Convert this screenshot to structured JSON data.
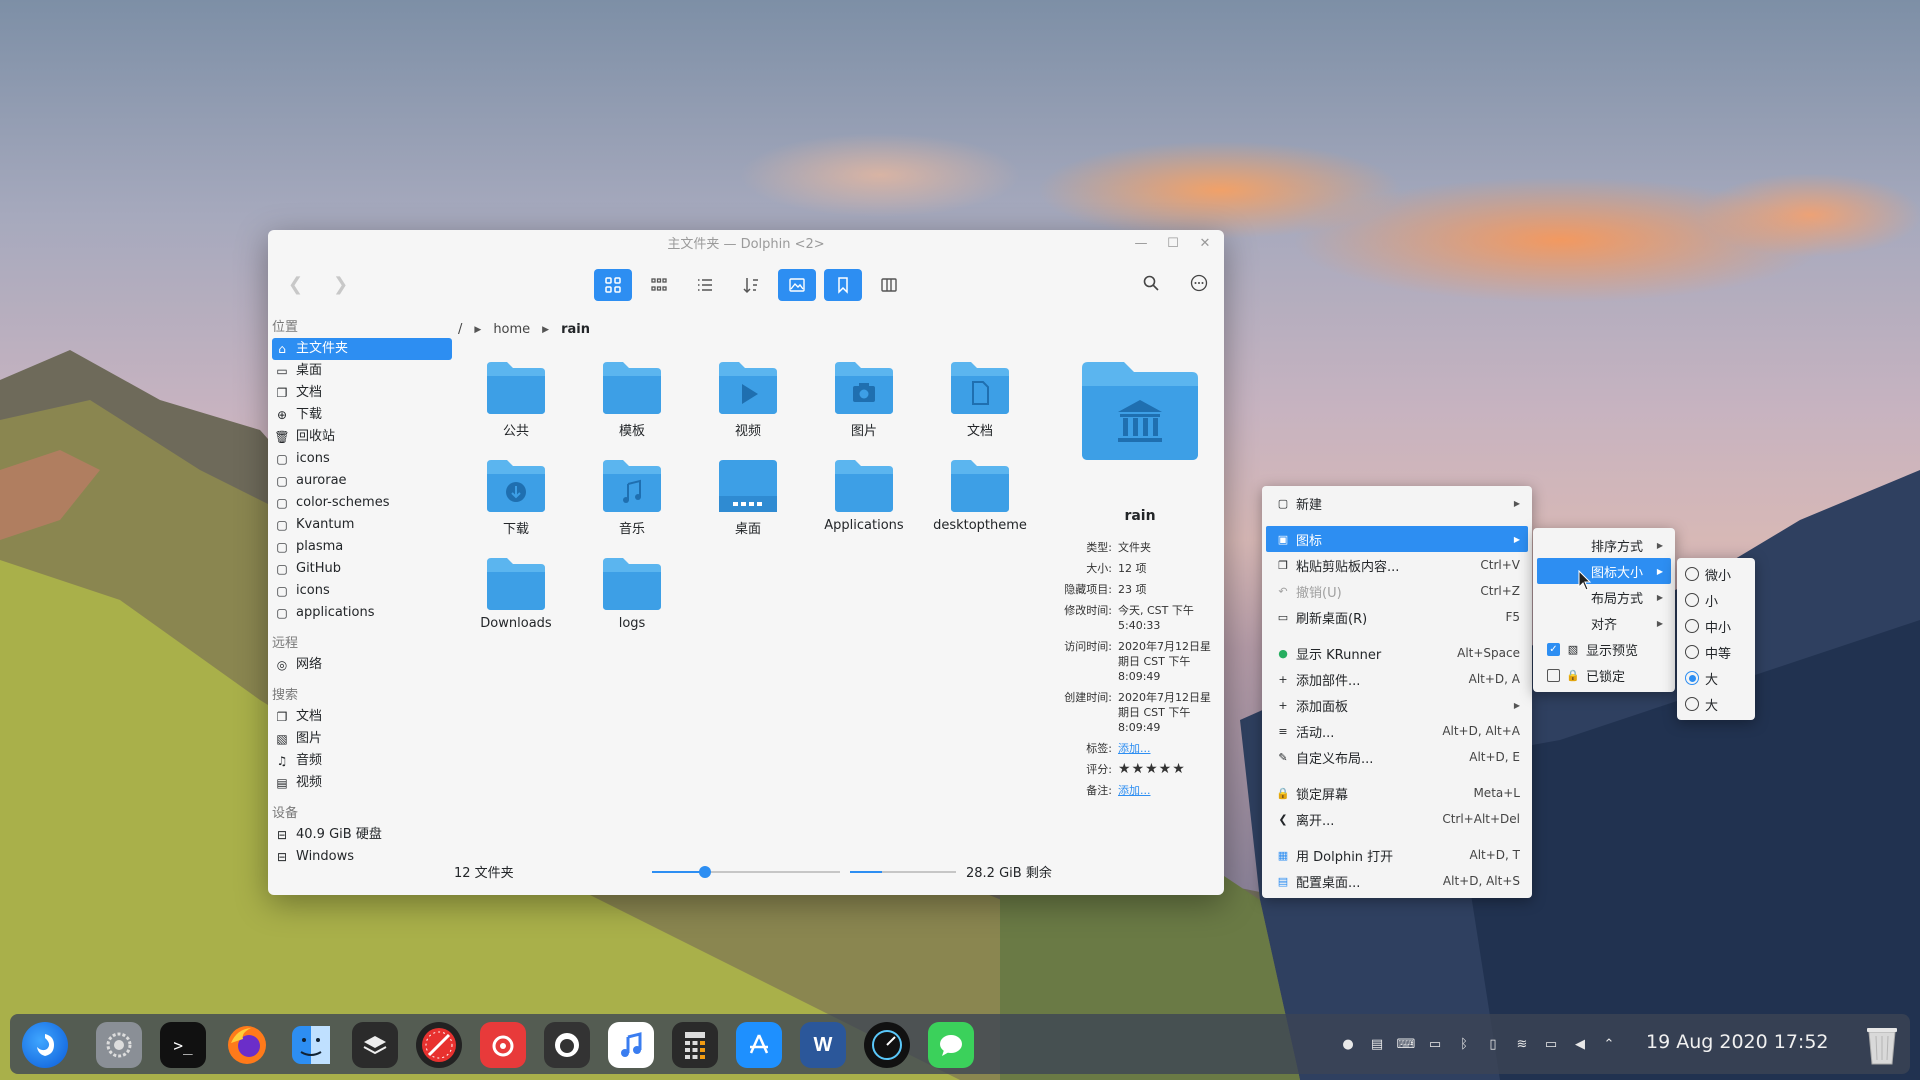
{
  "window": {
    "title": "主文件夹 — Dolphin <2>"
  },
  "sidebar": {
    "sections": {
      "places": "位置",
      "remote": "远程",
      "search": "搜索",
      "devices": "设备"
    },
    "places": [
      "主文件夹",
      "桌面",
      "文档",
      "下载",
      "回收站",
      "icons",
      "aurorae",
      "color-schemes",
      "Kvantum",
      "plasma",
      "GitHub",
      "icons",
      "applications"
    ],
    "remote": [
      "网络"
    ],
    "search": [
      "文档",
      "图片",
      "音频",
      "视频"
    ],
    "devices": [
      "40.9 GiB 硬盘",
      "Windows"
    ]
  },
  "breadcrumb": {
    "root": "/",
    "home": "home",
    "current": "rain"
  },
  "files": [
    "公共",
    "模板",
    "视频",
    "图片",
    "文档",
    "下载",
    "音乐",
    "桌面",
    "Applications",
    "desktoptheme",
    "Downloads",
    "logs"
  ],
  "info": {
    "name": "rain",
    "rows": [
      {
        "k": "类型:",
        "v": "文件夹"
      },
      {
        "k": "大小:",
        "v": "12 项"
      },
      {
        "k": "隐藏项目:",
        "v": "23 项"
      },
      {
        "k": "修改时间:",
        "v": "今天, CST 下午 5:40:33"
      },
      {
        "k": "访问时间:",
        "v": "2020年7月12日星期日 CST 下午 8:09:49"
      },
      {
        "k": "创建时间:",
        "v": "2020年7月12日星期日 CST 下午 8:09:49"
      }
    ],
    "tags_label": "标签:",
    "tags_value": "添加...",
    "rating_label": "评分:",
    "rating_value": "★★★★★",
    "comment_label": "备注:",
    "comment_value": "添加..."
  },
  "status": {
    "count": "12 文件夹",
    "free": "28.2 GiB 剩余",
    "zoom_fraction": 0.28,
    "space_fraction": 0.3
  },
  "menu_main": [
    {
      "icon": "new-icon",
      "label": "新建",
      "shortcut": "",
      "arrow": true
    },
    {
      "sep": true
    },
    {
      "icon": "icons-icon",
      "label": "图标",
      "shortcut": "",
      "arrow": true,
      "hl": true
    },
    {
      "icon": "paste-icon",
      "label": "粘贴剪贴板内容...",
      "shortcut": "Ctrl+V"
    },
    {
      "icon": "undo-icon",
      "label": "撤销(U)",
      "shortcut": "Ctrl+Z",
      "disabled": true
    },
    {
      "icon": "refresh-desktop-icon",
      "label": "刷新桌面(R)",
      "shortcut": "F5"
    },
    {
      "sep": true
    },
    {
      "icon": "krunner-icon",
      "label": "显示 KRunner",
      "shortcut": "Alt+Space"
    },
    {
      "icon": "add-widget-icon",
      "label": "添加部件...",
      "shortcut": "Alt+D, A"
    },
    {
      "icon": "add-panel-icon",
      "label": "添加面板",
      "shortcut": "",
      "arrow": true
    },
    {
      "icon": "activities-icon",
      "label": "活动...",
      "shortcut": "Alt+D, Alt+A"
    },
    {
      "icon": "customize-layout-icon",
      "label": "自定义布局...",
      "shortcut": "Alt+D, E"
    },
    {
      "sep": true
    },
    {
      "icon": "lock-screen-icon",
      "label": "锁定屏幕",
      "shortcut": "Meta+L"
    },
    {
      "icon": "leave-icon",
      "label": "离开...",
      "shortcut": "Ctrl+Alt+Del"
    },
    {
      "sep": true
    },
    {
      "icon": "dolphin-icon",
      "label": "用 Dolphin 打开",
      "shortcut": "Alt+D, T"
    },
    {
      "icon": "configure-desktop-icon",
      "label": "配置桌面...",
      "shortcut": "Alt+D, Alt+S"
    }
  ],
  "menu_icons": [
    {
      "label": "排序方式",
      "arrow": true
    },
    {
      "label": "图标大小",
      "arrow": true,
      "hl": true
    },
    {
      "label": "布局方式",
      "arrow": true
    },
    {
      "label": "对齐",
      "arrow": true
    },
    {
      "label": "显示预览",
      "check": true,
      "checked": true
    },
    {
      "label": "已锁定",
      "check": true,
      "checked": false
    }
  ],
  "menu_sizes": [
    {
      "label": "微小",
      "selected": false
    },
    {
      "label": "小",
      "selected": false
    },
    {
      "label": "中小",
      "selected": false
    },
    {
      "label": "中等",
      "selected": false
    },
    {
      "label": "大",
      "selected": true
    },
    {
      "label": "大",
      "selected": false
    }
  ],
  "dock": {
    "clock": "19 Aug 2020 17:52"
  },
  "colors": {
    "accent": "#2d8ef2",
    "folder": "#5bb5ef"
  }
}
